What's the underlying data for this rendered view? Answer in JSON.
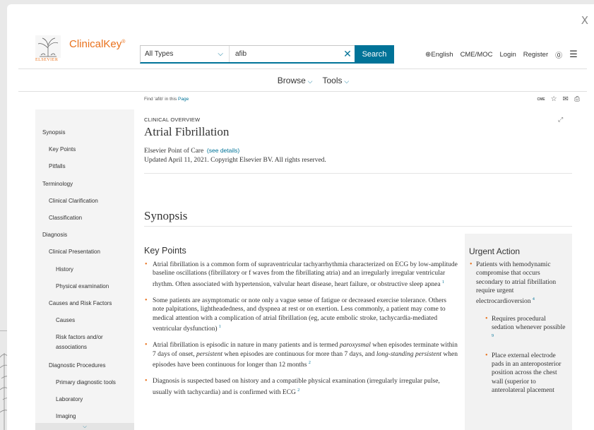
{
  "modal": {
    "close_label": "X"
  },
  "header": {
    "brand": "ClinicalKey",
    "brand_mark": "®",
    "publisher": "ELSEVIER",
    "search": {
      "type_value": "All Types",
      "query_value": "afib",
      "button_label": "Search"
    },
    "links": {
      "language": "English",
      "cme": "CME/MOC",
      "login": "Login",
      "register": "Register"
    },
    "icons": {
      "globe": "globe-icon",
      "help": "help-icon",
      "menu": "menu-icon"
    }
  },
  "browsebar": {
    "browse_label": "Browse",
    "tools_label": "Tools"
  },
  "findrow": {
    "prefix": "Find 'afib' in this ",
    "link": "Page"
  },
  "page_tools": {
    "cme_label": "CME"
  },
  "sidebar": {
    "items": [
      {
        "label": "Synopsis",
        "level": 1
      },
      {
        "label": "Key Points",
        "level": 2
      },
      {
        "label": "Pitfalls",
        "level": 2
      },
      {
        "label": "Terminology",
        "level": 1
      },
      {
        "label": "Clinical Clarification",
        "level": 2
      },
      {
        "label": "Classification",
        "level": 2
      },
      {
        "label": "Diagnosis",
        "level": 1
      },
      {
        "label": "Clinical Presentation",
        "level": 2
      },
      {
        "label": "History",
        "level": 3
      },
      {
        "label": "Physical examination",
        "level": 3
      },
      {
        "label": "Causes and Risk Factors",
        "level": 2
      },
      {
        "label": "Causes",
        "level": 3
      },
      {
        "label": "Risk factors and/or",
        "level": 3
      },
      {
        "label": "associations",
        "level": 3
      },
      {
        "label": "Diagnostic Procedures",
        "level": 2
      },
      {
        "label": "Primary diagnostic tools",
        "level": 3
      },
      {
        "label": "Laboratory",
        "level": 3
      },
      {
        "label": "Imaging",
        "level": 3
      }
    ]
  },
  "article": {
    "eyebrow": "CLINICAL OVERVIEW",
    "title": "Atrial Fibrillation",
    "source": "Elsevier Point of Care",
    "details_link": "(see details)",
    "updated": "Updated April 11, 2021. Copyright Elsevier BV. All rights reserved.",
    "section_title": "Synopsis",
    "key_points_title": "Key Points",
    "key_points": [
      {
        "html": "Atrial fibrillation is a common form of supraventricular tachyarrhythmia characterized on ECG by low-amplitude baseline oscillations (fibrillatory or f waves from the fibrillating atria) and an irregularly irregular ventricular rhythm. Often associated with hypertension, valvular heart disease, heart failure, or obstructive sleep apnea",
        "ref": "1"
      },
      {
        "html": "Some patients are asymptomatic or note only a vague sense of fatigue or decreased exercise tolerance. Others note palpitations, lightheadedness, and dyspnea at rest or on exertion. Less commonly, a patient may come to medical attention with a complication of atrial fibrillation (eg, acute embolic stroke, tachycardia-mediated ventricular dysfunction)",
        "ref": "1"
      },
      {
        "html": "Atrial fibrillation is episodic in nature in many patients and is termed <i>paroxysmal</i> when episodes terminate within 7 days of onset, <i>persistent</i> when episodes are continuous for more than 7 days, and <i>long-standing persistent</i> when episodes have been continuous for longer than 12 months",
        "ref": "2"
      },
      {
        "html": "Diagnosis is suspected based on history and a compatible physical examination (irregularly irregular pulse, usually with tachycardia) and is confirmed with ECG",
        "ref": "2"
      }
    ]
  },
  "urgent": {
    "title": "Urgent Action",
    "main_text": "Patients with hemodynamic compromise that occurs secondary to atrial fibrillation require urgent electrocardioversion",
    "main_ref": "4",
    "sub1_text": "Requires procedural sedation whenever possible",
    "sub1_ref": "9",
    "sub2_text": "Place external electrode pads in an anteroposterior position across the chest wall (superior to anterolateral placement"
  }
}
